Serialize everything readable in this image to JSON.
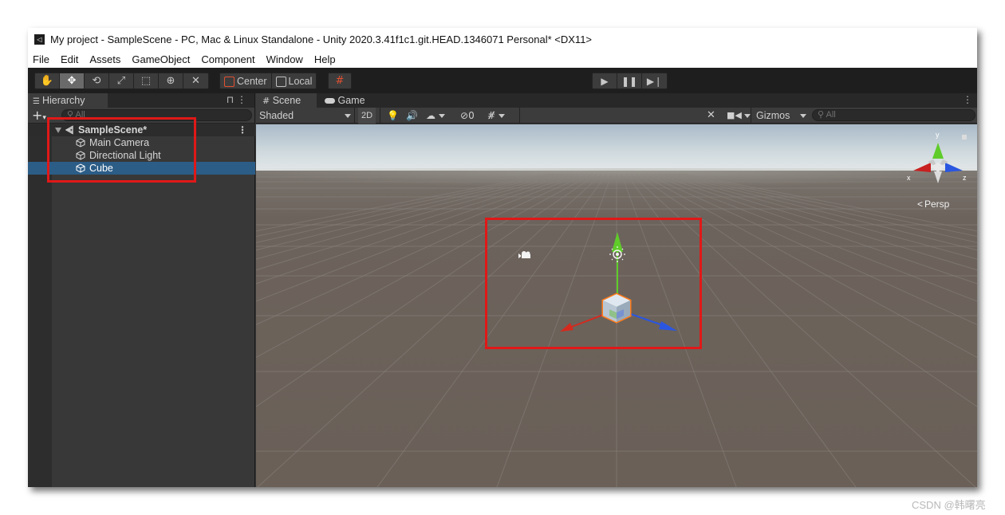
{
  "window": {
    "title": "My project - SampleScene - PC, Mac & Linux Standalone - Unity 2020.3.41f1c1.git.HEAD.1346071 Personal* <DX11>",
    "app_icon": "unity-logo-icon"
  },
  "menubar": [
    "File",
    "Edit",
    "Assets",
    "GameObject",
    "Component",
    "Window",
    "Help"
  ],
  "toolbar": {
    "tools": [
      {
        "name": "hand-tool",
        "glyph": "✋"
      },
      {
        "name": "move-tool",
        "glyph": "✥",
        "active": true
      },
      {
        "name": "rotate-tool",
        "glyph": "⟲"
      },
      {
        "name": "scale-tool",
        "glyph": "⤢"
      },
      {
        "name": "rect-tool",
        "glyph": "⬚"
      },
      {
        "name": "transform-tool",
        "glyph": "⊕"
      },
      {
        "name": "custom-tool",
        "glyph": "✕"
      }
    ],
    "pivot_center": "Center",
    "pivot_local": "Local",
    "grid_snap_icon": "grid-snap-icon",
    "play": "▶",
    "pause": "❚❚",
    "step": "▶❘"
  },
  "hierarchy": {
    "tab_label": "Hierarchy",
    "add_label": "+",
    "search_placeholder": "All",
    "scene_name": "SampleScene*",
    "items": [
      {
        "label": "Main Camera",
        "selected": false
      },
      {
        "label": "Directional Light",
        "selected": false
      },
      {
        "label": "Cube",
        "selected": true
      }
    ]
  },
  "scene_view": {
    "tabs": [
      {
        "label": "Scene",
        "icon": "grid-hash-icon",
        "active": true
      },
      {
        "label": "Game",
        "icon": "gamepad-icon",
        "active": false
      }
    ],
    "shading_mode": "Shaded",
    "mode_2d": "2D",
    "hidden_count": "0",
    "gizmos_label": "Gizmos",
    "search_placeholder": "All",
    "projection": "Persp",
    "axis_labels": {
      "x": "x",
      "y": "y",
      "z": "z"
    }
  },
  "colors": {
    "annotation": "#e01818",
    "selection": "#2c5d87",
    "axis_x": "#d42a1e",
    "axis_y": "#5fcc2a",
    "axis_z": "#2a56e0",
    "ground": "#6a6058"
  },
  "watermark": "CSDN @韩曙亮"
}
